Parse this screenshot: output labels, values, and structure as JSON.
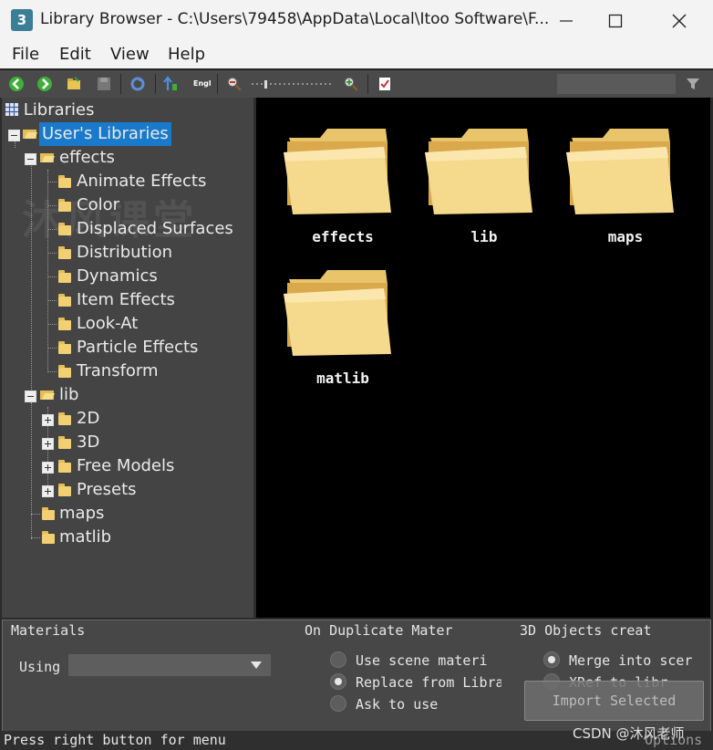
{
  "window": {
    "app_icon_text": "3",
    "title": "Library Browser - C:\\Users\\79458\\AppData\\Local\\Itoo Software\\F..."
  },
  "menu": [
    "File",
    "Edit",
    "View",
    "Help"
  ],
  "toolbar": {
    "language_label": "Engl",
    "search_value": ""
  },
  "tree": {
    "root_label": "Libraries",
    "user_libraries_label": "User's Libraries",
    "effects_label": "effects",
    "effects_children": [
      "Animate Effects",
      "Color",
      "Displaced Surfaces",
      "Distribution",
      "Dynamics",
      "Item Effects",
      "Look-At",
      "Particle Effects",
      "Transform"
    ],
    "lib_label": "lib",
    "lib_children": [
      "2D",
      "3D",
      "Free Models",
      "Presets"
    ],
    "maps_label": "maps",
    "matlib_label": "matlib"
  },
  "folders": [
    "effects",
    "lib",
    "maps",
    "matlib"
  ],
  "bottom": {
    "materials_label": "Materials",
    "using_label": "Using",
    "using_value": "",
    "duplicate_label": "On Duplicate Mater",
    "duplicate_options": [
      "Use scene materi",
      "Replace from Libra",
      "Ask to use"
    ],
    "duplicate_selected": 1,
    "objects_label": "3D Objects creat",
    "objects_options": [
      "Merge into scer",
      "XRef to libr"
    ],
    "objects_selected": 0,
    "import_button": "Import Selected",
    "options_label": "Options"
  },
  "status_text": "Press right button for menu",
  "watermarks": {
    "overlay_text": "沐风课堂",
    "csdn_text": "CSDN @沐风老师"
  },
  "colors": {
    "selection": "#1979ca",
    "folder": "#f1cf72",
    "panel": "#444444",
    "view_bg": "#000000"
  }
}
